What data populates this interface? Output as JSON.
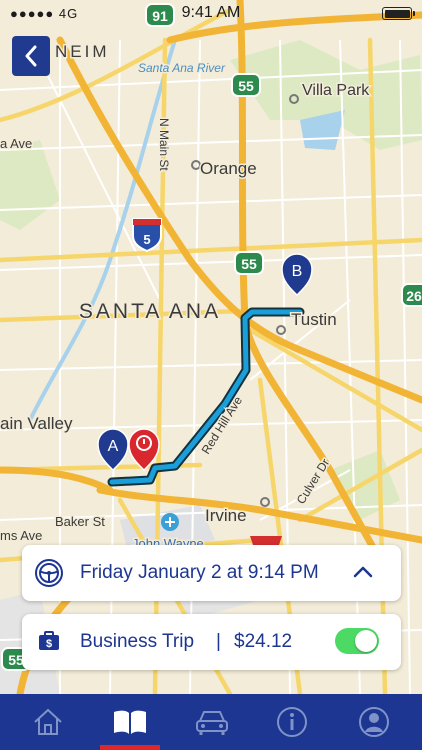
{
  "status": {
    "carrier": "●●●●● 4G",
    "time": "9:41 AM"
  },
  "map": {
    "labels": {
      "city_main": "SANTA ANA",
      "orange": "Orange",
      "villa_park": "Villa Park",
      "tustin": "Tustin",
      "irvine": "Irvine",
      "anaheim_partial": "NEIM",
      "fountain_valley_partial": "ain Valley",
      "ana_ave_partial": "a Ave",
      "santa_ana_river": "Santa Ana River",
      "n_main_st": "N Main St",
      "red_hill_ave": "Red Hill Ave",
      "culver_dr": "Culver Dr",
      "baker_st": "Baker St",
      "john_wayne": "John Wayne",
      "ms_ave_partial": "ms Ave"
    },
    "shields": {
      "hwy91": "91",
      "hwy55_north": "55",
      "i5": "5",
      "hwy55_mid": "55",
      "hwy261_partial": "26",
      "hwy55_south": "55"
    },
    "markers": {
      "start": "A",
      "end": "B"
    }
  },
  "trip": {
    "date_label": "Friday January 2 at 9:14 PM",
    "category": "Business Trip",
    "separator": "|",
    "amount": "$24.12",
    "business_enabled": true
  },
  "tabs": [
    {
      "name": "home",
      "icon": "home-icon",
      "active": false
    },
    {
      "name": "log",
      "icon": "book-icon",
      "active": true
    },
    {
      "name": "vehicles",
      "icon": "car-icon",
      "active": false
    },
    {
      "name": "info",
      "icon": "info-icon",
      "active": false
    },
    {
      "name": "profile",
      "icon": "profile-icon",
      "active": false
    }
  ],
  "colors": {
    "brand_blue": "#1d3691",
    "route": "#1a9fd9",
    "marker_start": "#1f3a8f",
    "marker_end": "#d9272e",
    "toggle_on": "#4cd964",
    "tab_active": "#e02727"
  }
}
